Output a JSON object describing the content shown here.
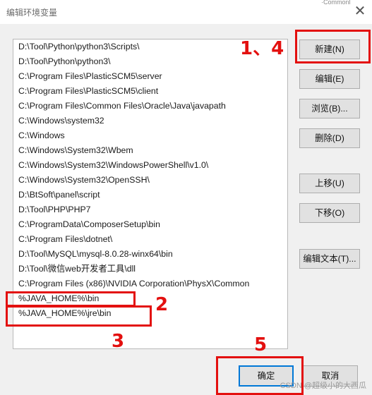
{
  "window": {
    "title": "编辑环境变量",
    "close_label": "✕",
    "corner_text": "·Commonl"
  },
  "paths": [
    "D:\\Tool\\Python\\python3\\Scripts\\",
    "D:\\Tool\\Python\\python3\\",
    "C:\\Program Files\\PlasticSCM5\\server",
    "C:\\Program Files\\PlasticSCM5\\client",
    "C:\\Program Files\\Common Files\\Oracle\\Java\\javapath",
    "C:\\Windows\\system32",
    "C:\\Windows",
    "C:\\Windows\\System32\\Wbem",
    "C:\\Windows\\System32\\WindowsPowerShell\\v1.0\\",
    "C:\\Windows\\System32\\OpenSSH\\",
    "D:\\BtSoft\\panel\\script",
    "D:\\Tool\\PHP\\PHP7",
    "C:\\ProgramData\\ComposerSetup\\bin",
    "C:\\Program Files\\dotnet\\",
    "D:\\Tool\\MySQL\\mysql-8.0.28-winx64\\bin",
    "D:\\Tool\\微信web开发者工具\\dll",
    "C:\\Program Files (x86)\\NVIDIA Corporation\\PhysX\\Common",
    "%JAVA_HOME%\\bin",
    "%JAVA_HOME%\\jre\\bin",
    ""
  ],
  "buttons": {
    "new": "新建(N)",
    "edit": "编辑(E)",
    "browse": "浏览(B)...",
    "delete": "删除(D)",
    "move_up": "上移(U)",
    "move_down": "下移(O)",
    "edit_text": "编辑文本(T)...",
    "ok": "确定",
    "cancel": "取消"
  },
  "annotations": {
    "step_1_4": "1、4",
    "step_2": "2",
    "step_3": "3",
    "step_5": "5"
  },
  "watermark": "CSDN @超级小的大西瓜",
  "colors": {
    "annotation": "#e3100f",
    "focus": "#0078d7"
  }
}
